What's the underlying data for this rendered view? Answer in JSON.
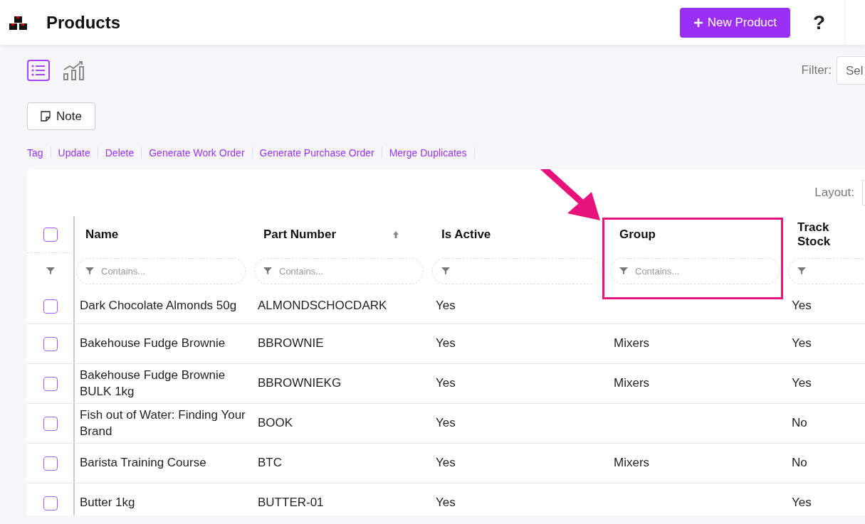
{
  "header": {
    "title": "Products",
    "new_button": "New Product",
    "help": "?"
  },
  "views": [
    {
      "kind": "list",
      "selected": true
    },
    {
      "kind": "chart",
      "selected": false
    }
  ],
  "filter": {
    "label": "Filter:",
    "value": "Sel"
  },
  "note_button": "Note",
  "actions": [
    "Tag",
    "Update",
    "Delete",
    "Generate Work Order",
    "Generate Purchase Order",
    "Merge Duplicates"
  ],
  "layout": {
    "label": "Layout:"
  },
  "table": {
    "all_checked": false,
    "columns": [
      {
        "label": "Name",
        "sorted": false,
        "highlighted": false,
        "placeholder": "Contains..."
      },
      {
        "label": "Part Number",
        "sorted": true,
        "highlighted": false,
        "placeholder": "Contains..."
      },
      {
        "label": "Is Active",
        "sorted": false,
        "highlighted": false
      },
      {
        "label": "Group",
        "sorted": false,
        "highlighted": true,
        "placeholder": "Contains..."
      },
      {
        "label": "Track Stock",
        "sorted": false,
        "highlighted": false
      }
    ],
    "rows": [
      {
        "checked": false,
        "cells": [
          "Dark Chocolate Almonds 50g",
          "ALMONDSCHOCDARK",
          "Yes",
          "",
          "Yes"
        ]
      },
      {
        "checked": false,
        "cells": [
          "Bakehouse Fudge Brownie",
          "BBROWNIE",
          "Yes",
          "Mixers",
          "Yes"
        ]
      },
      {
        "checked": false,
        "cells": [
          "Bakehouse Fudge Brownie BULK 1kg",
          "BBROWNIEKG",
          "Yes",
          "Mixers",
          "Yes"
        ]
      },
      {
        "checked": false,
        "cells": [
          "Fish out of Water: Finding Your Brand",
          "BOOK",
          "Yes",
          "",
          "No"
        ]
      },
      {
        "checked": false,
        "cells": [
          "Barista Training Course",
          "BTC",
          "Yes",
          "Mixers",
          "No"
        ]
      },
      {
        "checked": false,
        "cells": [
          "Butter 1kg",
          "BUTTER-01",
          "Yes",
          "",
          "Yes"
        ]
      }
    ]
  }
}
